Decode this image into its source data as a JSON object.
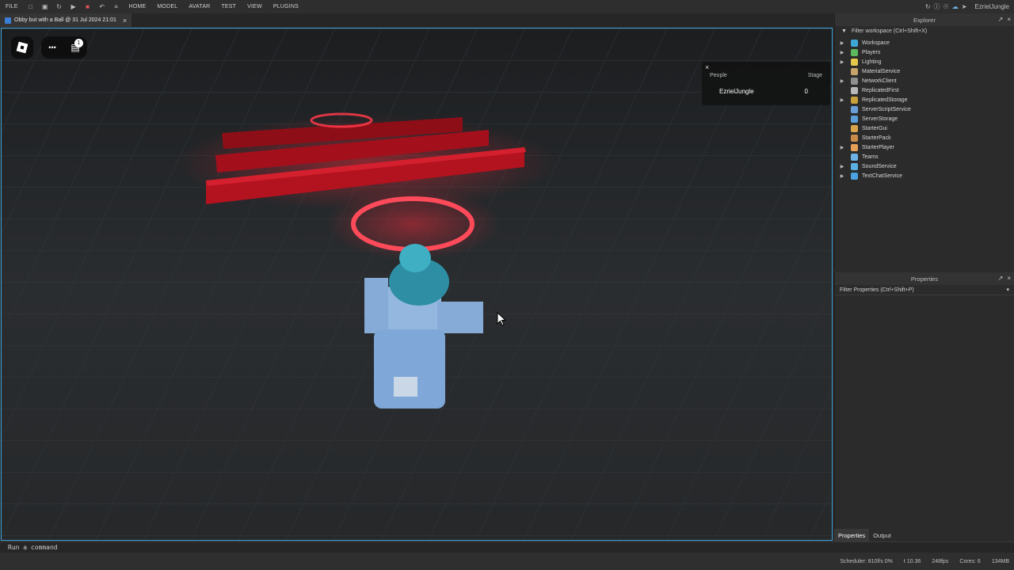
{
  "menu": {
    "file": "FILE",
    "items": [
      "HOME",
      "MODEL",
      "AVATAR",
      "TEST",
      "VIEW",
      "PLUGINS"
    ],
    "username": "EzrielJungle"
  },
  "tab": {
    "title": "Obby but with a Ball @ 31 Jul 2024 21:01"
  },
  "viewport": {
    "chat_badge": "1",
    "more_glyph": "•••"
  },
  "leaderboard": {
    "col_people": "People",
    "col_stage": "Stage",
    "player_name": "EzrielJungle",
    "player_stage": "0"
  },
  "explorer": {
    "title": "Explorer",
    "filter": "Filter workspace (Ctrl+Shift+X)",
    "items": [
      {
        "label": "Workspace",
        "expandable": true,
        "color": "#3fa7d6",
        "icon": "workspace-icon"
      },
      {
        "label": "Players",
        "expandable": true,
        "color": "#5cb85c",
        "icon": "players-icon"
      },
      {
        "label": "Lighting",
        "expandable": true,
        "color": "#e6c84a",
        "icon": "lighting-icon"
      },
      {
        "label": "MaterialService",
        "expandable": false,
        "color": "#c7a36b",
        "icon": "material-service-icon"
      },
      {
        "label": "NetworkClient",
        "expandable": true,
        "color": "#8f8f8f",
        "icon": "network-client-icon"
      },
      {
        "label": "ReplicatedFirst",
        "expandable": false,
        "color": "#b9b9b9",
        "icon": "replicated-first-icon"
      },
      {
        "label": "ReplicatedStorage",
        "expandable": true,
        "color": "#c9a13b",
        "icon": "replicated-storage-icon"
      },
      {
        "label": "ServerScriptService",
        "expandable": false,
        "color": "#6aa0d8",
        "icon": "server-script-service-icon"
      },
      {
        "label": "ServerStorage",
        "expandable": false,
        "color": "#5c9fd8",
        "icon": "server-storage-icon"
      },
      {
        "label": "StarterGui",
        "expandable": false,
        "color": "#d8a54a",
        "icon": "starter-gui-icon"
      },
      {
        "label": "StarterPack",
        "expandable": false,
        "color": "#c98b4a",
        "icon": "starter-pack-icon"
      },
      {
        "label": "StarterPlayer",
        "expandable": true,
        "color": "#e6a05a",
        "icon": "starter-player-icon"
      },
      {
        "label": "Teams",
        "expandable": false,
        "color": "#6fb3e6",
        "icon": "teams-icon"
      },
      {
        "label": "SoundService",
        "expandable": true,
        "color": "#5ab0e0",
        "icon": "sound-service-icon"
      },
      {
        "label": "TextChatService",
        "expandable": true,
        "color": "#4aa3e0",
        "icon": "text-chat-service-icon"
      }
    ]
  },
  "properties": {
    "title": "Properties",
    "filter": "Filter Properties (Ctrl+Shift+P)"
  },
  "bottom_tabs": {
    "properties": "Properties",
    "output": "Output"
  },
  "command": {
    "placeholder": "Run a command"
  },
  "status": {
    "scheduler": "Scheduler: 810f/s 0%",
    "time": "t 10.36",
    "fps": "248fps",
    "cores": "Cores: 6",
    "memory": "134MB"
  },
  "colors": {
    "accent": "#3ea2d8",
    "neon": "#ff2a3a",
    "obstacle": "#b3121f",
    "avatar": "#7fa8d8"
  }
}
